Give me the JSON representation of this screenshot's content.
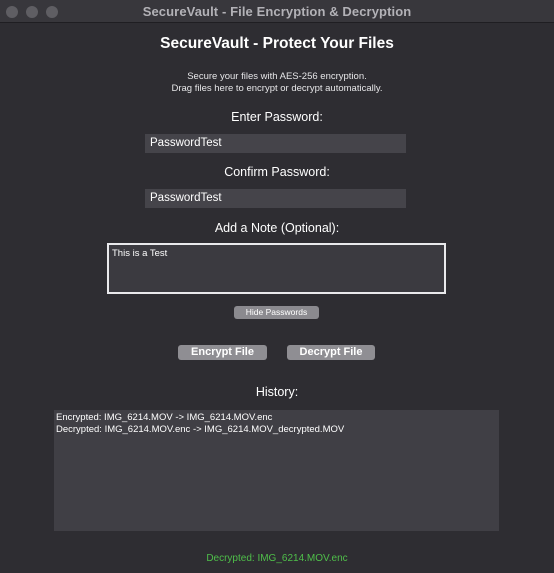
{
  "window": {
    "title": "SecureVault - File Encryption & Decryption"
  },
  "header": {
    "title": "SecureVault - Protect Your Files",
    "subtitle_line1": "Secure your files with AES-256 encryption.",
    "subtitle_line2": "Drag files here to encrypt or decrypt automatically."
  },
  "form": {
    "password_label": "Enter Password:",
    "password_value": "PasswordTest",
    "confirm_label": "Confirm Password:",
    "confirm_value": "PasswordTest",
    "note_label": "Add a Note (Optional):",
    "note_value": "This is a Test",
    "toggle_label": "Hide Passwords"
  },
  "actions": {
    "encrypt_label": "Encrypt File",
    "decrypt_label": "Decrypt File"
  },
  "history": {
    "label": "History:",
    "entries": [
      "Encrypted: IMG_6214.MOV -> IMG_6214.MOV.enc",
      "Decrypted: IMG_6214.MOV.enc -> IMG_6214.MOV_decrypted.MOV"
    ]
  },
  "status": {
    "text": "Decrypted: IMG_6214.MOV.enc",
    "color": "#4fbf4a"
  },
  "icons": {
    "window_controls": [
      "close-icon",
      "minimize-icon",
      "zoom-icon"
    ]
  }
}
